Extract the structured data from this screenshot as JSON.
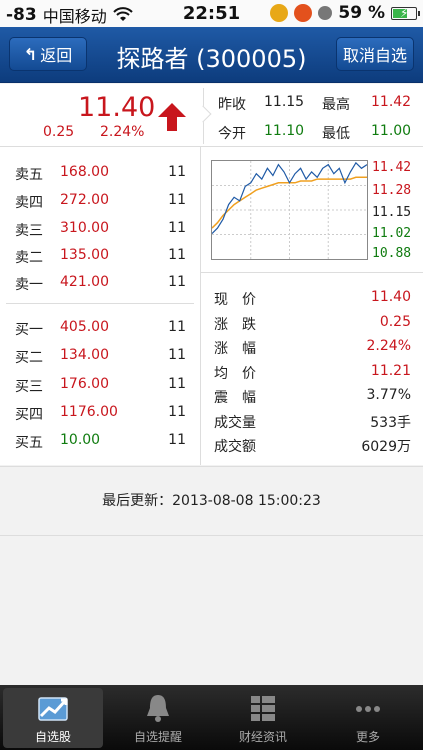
{
  "status_bar": {
    "signal": "-83",
    "carrier": "中国移动",
    "time": "22:51",
    "battery": "59 %"
  },
  "nav": {
    "back_label": "返回",
    "title": "探路者 (300005)",
    "cancel_label": "取消自选"
  },
  "quote": {
    "price": "11.40",
    "change": "0.25",
    "change_pct": "2.24%",
    "prev_close_label": "昨收",
    "prev_close": "11.15",
    "high_label": "最高",
    "high": "11.42",
    "open_label": "今开",
    "open": "11.10",
    "low_label": "最低",
    "low": "11.00"
  },
  "sell_orders": [
    {
      "label": "卖五",
      "price": "168.00",
      "volume": "11"
    },
    {
      "label": "卖四",
      "price": "272.00",
      "volume": "11"
    },
    {
      "label": "卖三",
      "price": "310.00",
      "volume": "11"
    },
    {
      "label": "卖二",
      "price": "135.00",
      "volume": "11"
    },
    {
      "label": "卖一",
      "price": "421.00",
      "volume": "11"
    }
  ],
  "buy_orders": [
    {
      "label": "买一",
      "price": "405.00",
      "volume": "11"
    },
    {
      "label": "买二",
      "price": "134.00",
      "volume": "11"
    },
    {
      "label": "买三",
      "price": "176.00",
      "volume": "11"
    },
    {
      "label": "买四",
      "price": "1176.00",
      "volume": "11"
    },
    {
      "label": "买五",
      "price": "10.00",
      "volume": "11"
    }
  ],
  "chart_data": {
    "type": "line",
    "ylim": [
      10.88,
      11.42
    ],
    "y_ticks": [
      "11.42",
      "11.28",
      "11.15",
      "11.02",
      "10.88"
    ],
    "grid": true,
    "series": [
      {
        "values": [
          11.02,
          11.05,
          11.1,
          11.18,
          11.22,
          11.2,
          11.28,
          11.3,
          11.35,
          11.32,
          11.38,
          11.34,
          11.4,
          11.36,
          11.3,
          11.35,
          11.38,
          11.32,
          11.36,
          11.33,
          11.38,
          11.4,
          11.35,
          11.38,
          11.3,
          11.36,
          11.41,
          11.38,
          11.4
        ]
      },
      {
        "values": [
          11.05,
          11.08,
          11.12,
          11.15,
          11.18,
          11.2,
          11.22,
          11.24,
          11.26,
          11.27,
          11.28,
          11.29,
          11.3,
          11.3,
          11.3,
          11.3,
          11.31,
          11.31,
          11.31,
          11.32,
          11.32,
          11.32,
          11.32,
          11.32,
          11.32,
          11.32,
          11.33,
          11.33,
          11.33
        ]
      }
    ],
    "colors": {
      "price": "#1f5aa6",
      "average": "#f0a020"
    }
  },
  "stats": [
    {
      "key": "现　价",
      "value": "11.40",
      "color": "red"
    },
    {
      "key": "涨　跌",
      "value": "0.25",
      "color": "red"
    },
    {
      "key": "涨　幅",
      "value": "2.24%",
      "color": "red"
    },
    {
      "key": "均　价",
      "value": "11.21",
      "color": "red"
    },
    {
      "key": "震　幅",
      "value": "3.77%",
      "color": "dark"
    },
    {
      "key": "成交量",
      "value": "533手",
      "color": "dark"
    },
    {
      "key": "成交额",
      "value": "6029万",
      "color": "dark"
    }
  ],
  "update": {
    "text": "最后更新：2013-08-08 15:00:23"
  },
  "tabs": [
    {
      "label": "自选股",
      "icon": "portfolio-chart-icon"
    },
    {
      "label": "自选提醒",
      "icon": "bell-icon"
    },
    {
      "label": "财经资讯",
      "icon": "news-list-icon"
    },
    {
      "label": "更多",
      "icon": "more-dots-icon"
    }
  ]
}
